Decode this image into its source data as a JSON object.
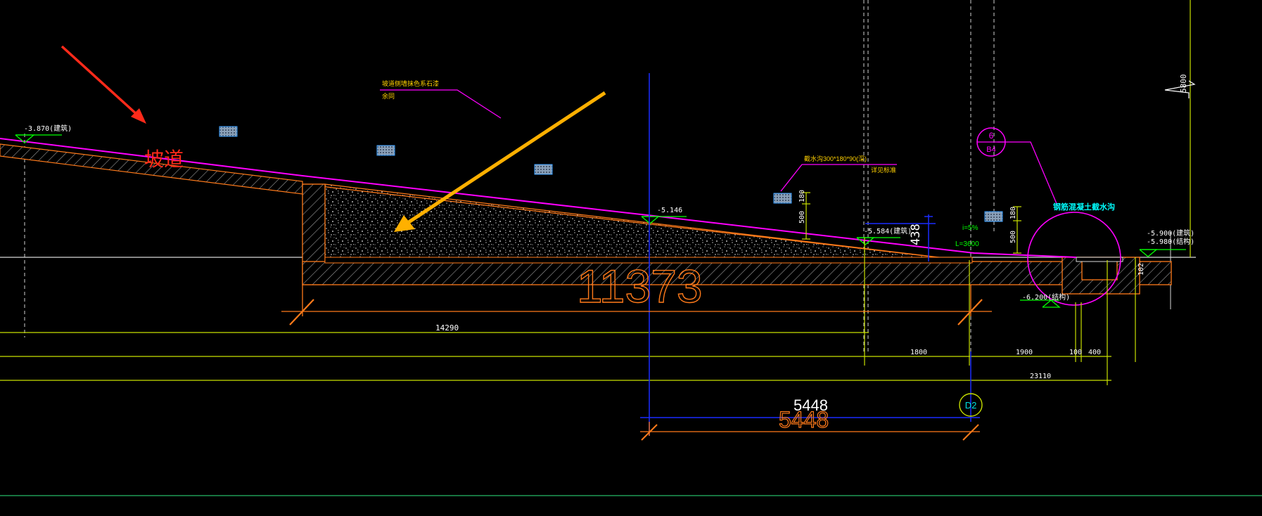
{
  "labels": {
    "ramp": "坡道",
    "elev_left": "-3.870(建筑)",
    "elev_mid": "-5.146",
    "elev_right_mid": "-5.584(建筑)",
    "elev_right_a": "-5.900(建筑)",
    "elev_right_b": "-5.980(结构)",
    "elev_pit": "-6.200(结构)",
    "note_top_a": "坡道侧墙抹色系石漆",
    "note_top_b": "余同",
    "note_drain_a": "截水沟300*180*90(深)",
    "note_drain_b": "详见标准",
    "note_circle": "钢筋混凝土截水沟",
    "slope_i": "i=5%",
    "slope_L": "L=3600",
    "big_dim": "11373",
    "dim_14290": "14290",
    "dim_1800": "1800",
    "dim_1900": "1900",
    "dim_100": "100",
    "dim_400": "400",
    "dim_23110": "23110",
    "dim_5448_white": "5448",
    "dim_5448_orange": "5448",
    "dim_438": "438",
    "dim_500_a": "500",
    "dim_180_a": "180",
    "dim_500_b": "500",
    "dim_180_b": "180",
    "dim_102": "102",
    "dim_5800": "5800",
    "grid_d2": "D2",
    "callout_top": "6",
    "callout_bottom": "B4"
  },
  "colors": {
    "background": "#000000",
    "magenta": "#ff00ff",
    "orange": "#ff7a1a",
    "yellow_arrow": "#ffb000",
    "red_arrow": "#ff2a1a",
    "green": "#00ff00",
    "yellow_green": "#c8e000",
    "blue": "#1a2cff",
    "white": "#e6e6e6",
    "grey": "#b0b0b0"
  }
}
